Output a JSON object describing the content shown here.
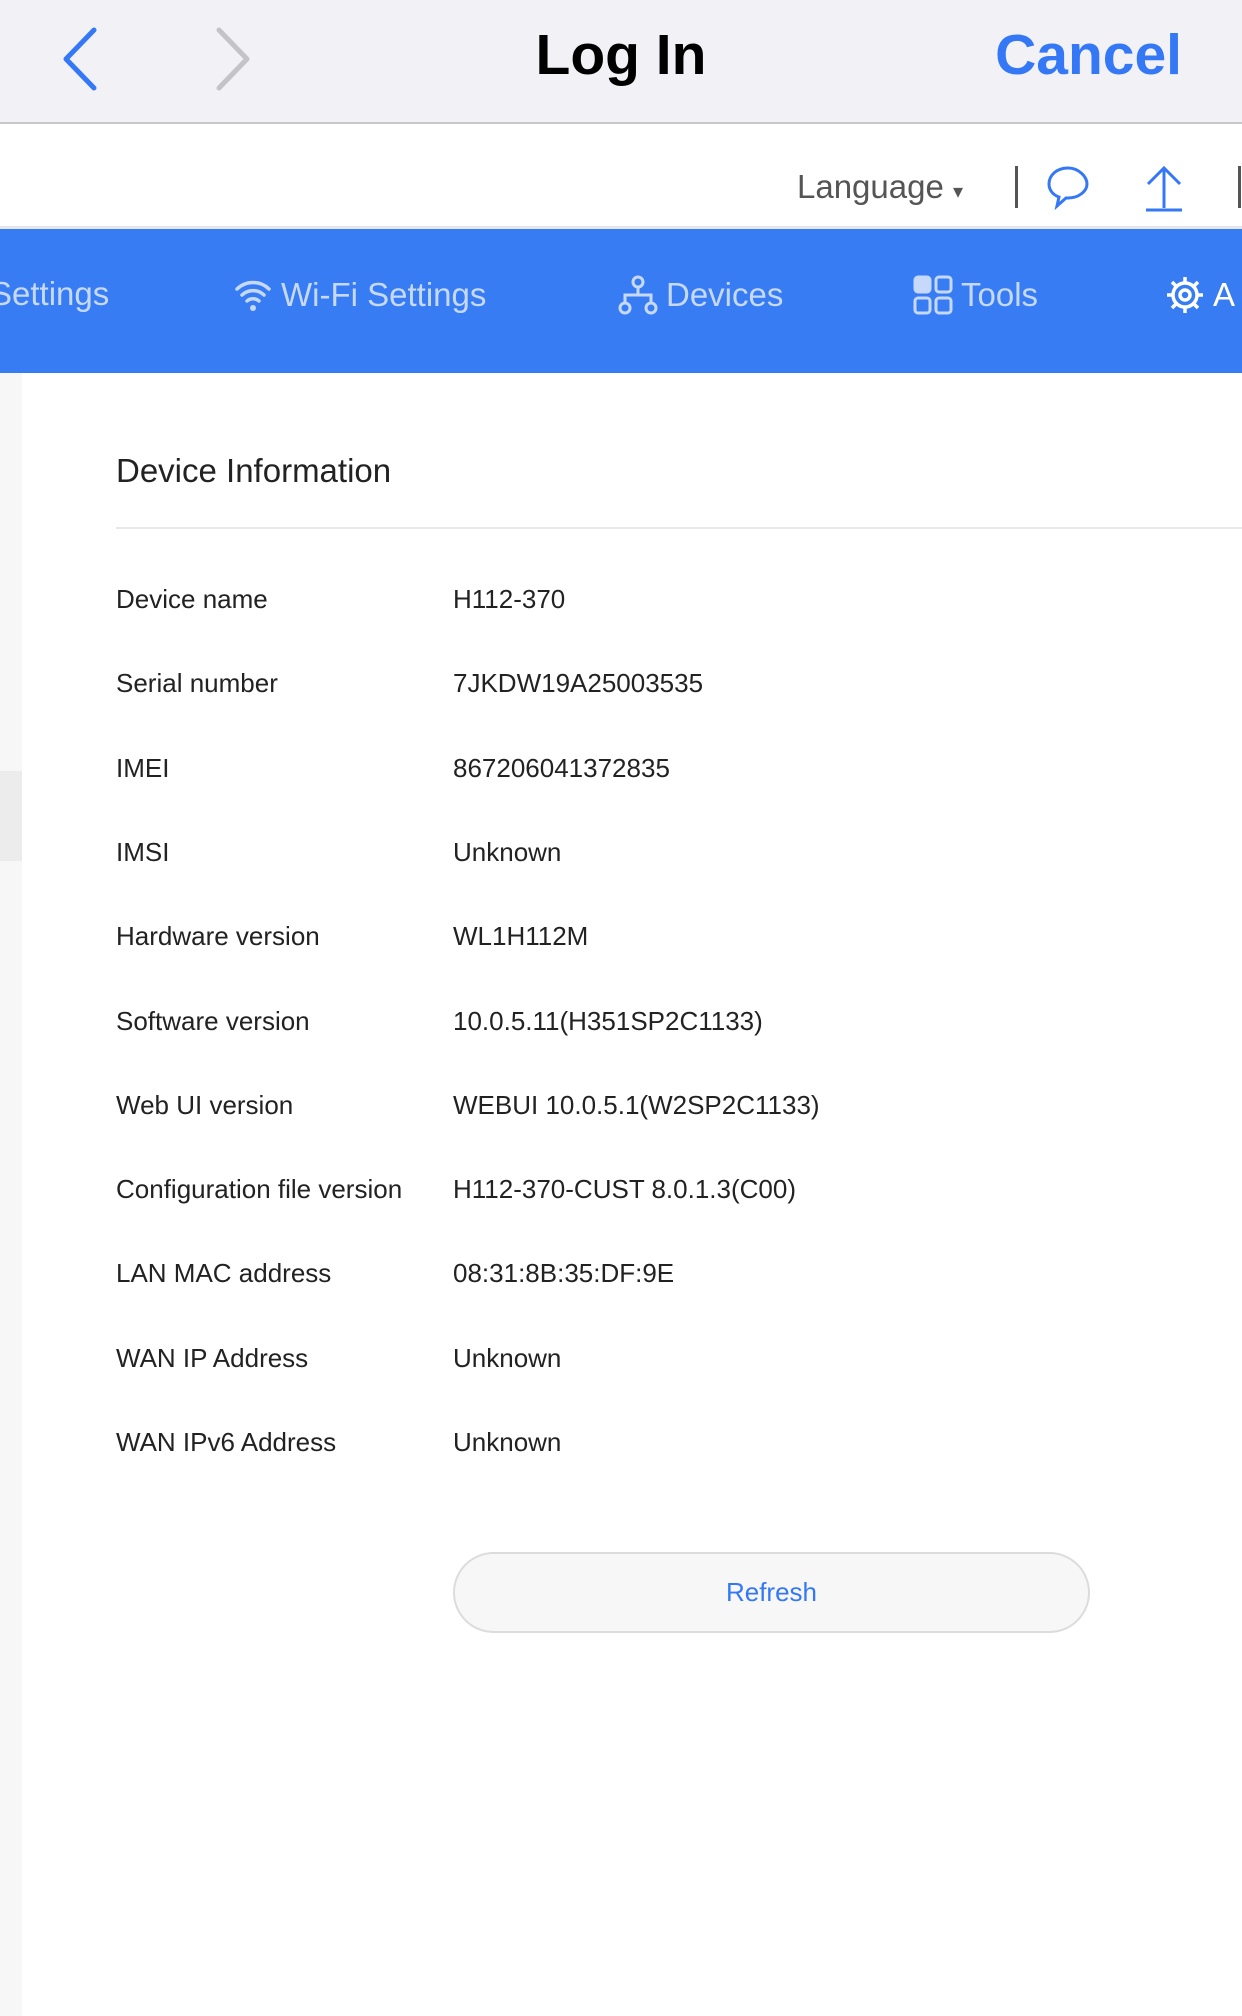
{
  "navbar": {
    "title": "Log In",
    "cancel_label": "Cancel",
    "back_icon": "chevron-left-icon",
    "forward_icon": "chevron-right-icon",
    "accent": "#3478f6"
  },
  "toolbar": {
    "language_label": "Language",
    "language_caret": "▾",
    "icons": [
      "chat-bubble-icon",
      "upload-arrow-icon"
    ]
  },
  "tabs": {
    "bg": "#387cf3",
    "items": [
      {
        "label": "Settings",
        "icon": null
      },
      {
        "label": "Wi-Fi Settings",
        "icon": "wifi-icon"
      },
      {
        "label": "Devices",
        "icon": "network-icon"
      },
      {
        "label": "Tools",
        "icon": "grid-icon"
      },
      {
        "label": "A",
        "icon": "gear-icon"
      }
    ]
  },
  "main": {
    "title": "Device Information",
    "rows": [
      {
        "label": "Device name",
        "value": "H112-370"
      },
      {
        "label": "Serial number",
        "value": "7JKDW19A25003535"
      },
      {
        "label": "IMEI",
        "value": "867206041372835"
      },
      {
        "label": "IMSI",
        "value": "Unknown"
      },
      {
        "label": "Hardware version",
        "value": "WL1H112M"
      },
      {
        "label": "Software version",
        "value": "10.0.5.11(H351SP2C1133)"
      },
      {
        "label": "Web UI version",
        "value": "WEBUI 10.0.5.1(W2SP2C1133)"
      },
      {
        "label": "Configuration file version",
        "value": "H112-370-CUST 8.0.1.3(C00)"
      },
      {
        "label": "LAN MAC address",
        "value": "08:31:8B:35:DF:9E"
      },
      {
        "label": "WAN IP Address",
        "value": "Unknown"
      },
      {
        "label": "WAN IPv6 Address",
        "value": "Unknown"
      }
    ],
    "refresh_label": "Refresh"
  }
}
